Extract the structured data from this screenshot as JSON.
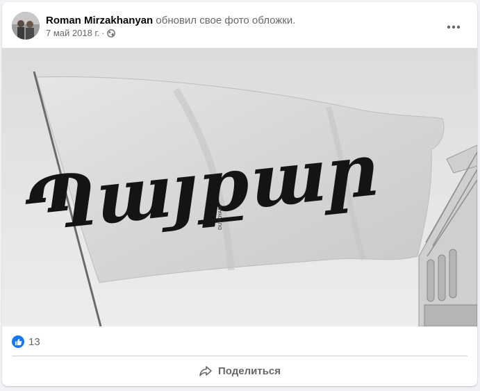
{
  "post": {
    "author": "Roman Mirzakhanyan",
    "action": "обновил свое фото обложки.",
    "timestamp": "7 май 2018 г.",
    "separator": "·",
    "privacy_icon": "globe-icon",
    "more_icon": "more-options-icon"
  },
  "photo": {
    "flag_text": "Պայքար",
    "flag_small_text": "DUKOYAM"
  },
  "reactions": {
    "icon": "like-icon",
    "count": "13"
  },
  "actions": {
    "share_label": "Поделиться",
    "share_icon": "share-icon"
  },
  "colors": {
    "accent": "#1877f2",
    "secondary_text": "#65676b",
    "background": "#f0f2f5"
  }
}
